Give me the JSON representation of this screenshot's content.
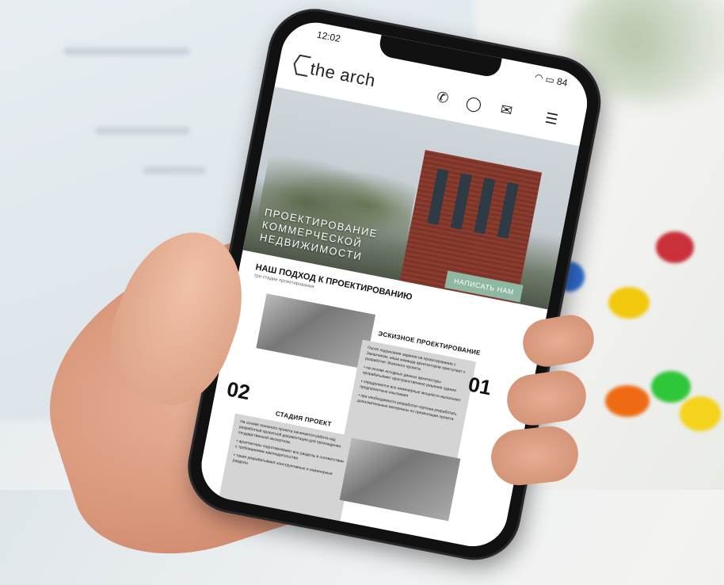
{
  "status_bar": {
    "time": "12:02",
    "battery": "84"
  },
  "site": {
    "logo_text": "the arch",
    "nav_icons": [
      "phone-icon",
      "whatsapp-icon",
      "mail-icon",
      "menu-icon"
    ]
  },
  "hero": {
    "title_line1": "ПРОЕКТИРОВАНИЕ",
    "title_line2": "КОММЕРЧЕСКОЙ НЕДВИЖИМОСТИ",
    "cta_label": "НАПИСАТЬ НАМ"
  },
  "approach": {
    "title": "НАШ ПОДХОД К ПРОЕКТИРОВАНИЮ",
    "subtitle": "три стадии проектирования"
  },
  "stages": [
    {
      "number": "01",
      "title": "ЭСКИЗНОЕ ПРОЕКТИРОВАНИЕ",
      "text": [
        "После подписания задания на проектирование с Заказчиком, наша команда архитекторов приступает к разработке Эскизного проекта.",
        "• на основе исходных данных архитекторы прорабатывают пространственное решение здания",
        "• определяются все инженерные мощности выполняют предпроектные изыскания",
        "• при необходимости разработки чертежа разработать дополнительные материалы по презентации проекта"
      ]
    },
    {
      "number": "02",
      "title": "СТАДИЯ ПРОЕКТ",
      "text": [
        "На основе эскизного проекта начинается работа над разработкой проектной документации для прохождения государственной экспертизы.",
        "• архитекторы подготавливают все разделы в соответствии с требованиями законодательства",
        "• также разрабатывают конструктивные и инженерные разделы"
      ]
    }
  ],
  "colors": {
    "cta_bg": "#8fb8a3",
    "stage_box_bg": "#d4d4d4",
    "brick": "#8a3c2e"
  }
}
